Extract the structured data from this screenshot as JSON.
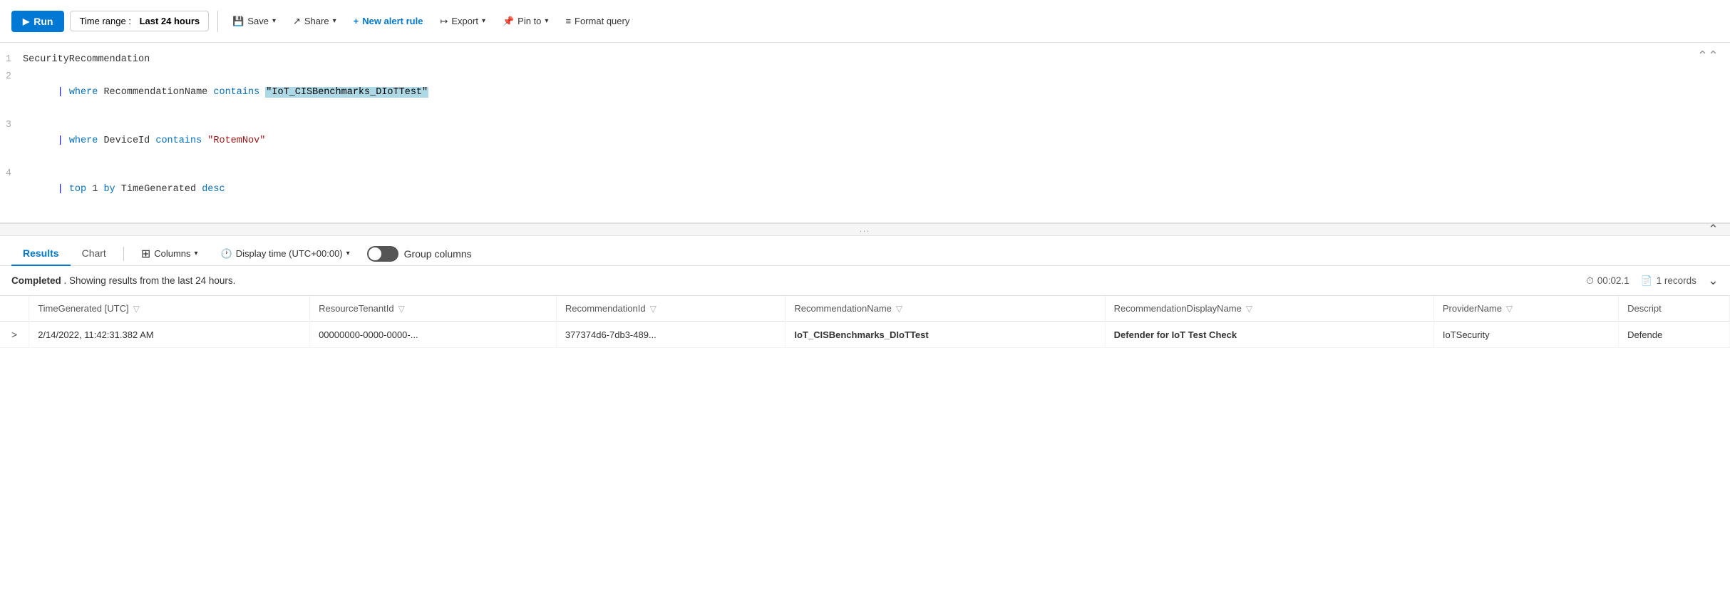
{
  "toolbar": {
    "run_label": "Run",
    "time_range_prefix": "Time range :",
    "time_range_value": "Last 24 hours",
    "save_label": "Save",
    "share_label": "Share",
    "new_alert_label": "New alert rule",
    "export_label": "Export",
    "pin_to_label": "Pin to",
    "format_query_label": "Format query"
  },
  "query": {
    "lines": [
      {
        "number": "1",
        "content": "SecurityRecommendation"
      },
      {
        "number": "2",
        "content": "| where RecommendationName contains \"IoT_CISBenchmarks_DIoTTest\""
      },
      {
        "number": "3",
        "content": "| where DeviceId contains \"RotemNov\""
      },
      {
        "number": "4",
        "content": "| top 1 by TimeGenerated desc"
      }
    ]
  },
  "resize_handle": "...",
  "results": {
    "tabs": [
      {
        "label": "Results",
        "active": true
      },
      {
        "label": "Chart",
        "active": false
      }
    ],
    "columns_label": "Columns",
    "display_time_label": "Display time (UTC+00:00)",
    "group_columns_label": "Group columns",
    "status_text": "Completed",
    "status_detail": ". Showing results from the last 24 hours.",
    "elapsed_time": "00:02.1",
    "record_count": "1 records",
    "table": {
      "headers": [
        "TimeGenerated [UTC]",
        "ResourceTenantId",
        "RecommendationId",
        "RecommendationName",
        "RecommendationDisplayName",
        "ProviderName",
        "Descript"
      ],
      "rows": [
        {
          "expand": ">",
          "time": "2/14/2022, 11:42:31.382 AM",
          "tenant": "00000000-0000-0000-...",
          "rec_id": "377374d6-7db3-489...",
          "rec_name": "IoT_CISBenchmarks_DIoTTest",
          "display_name": "Defender for IoT Test Check",
          "provider": "IoTSecurity",
          "description": "Defende"
        }
      ]
    }
  }
}
